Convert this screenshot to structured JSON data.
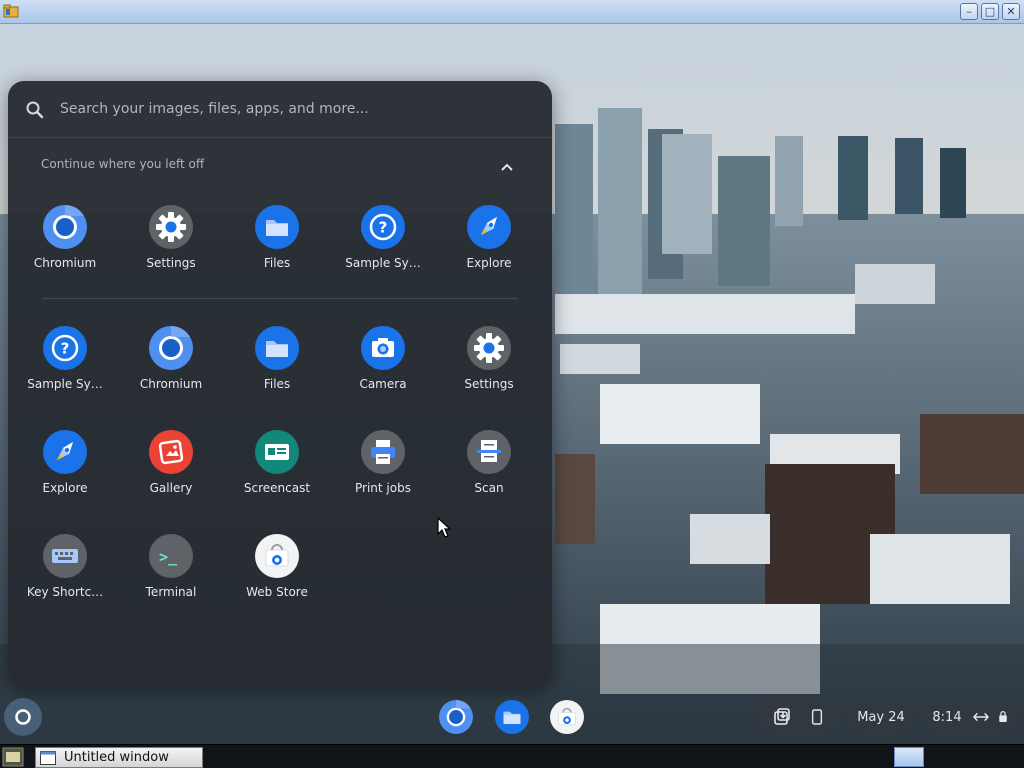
{
  "window": {
    "app_icon": "folder-icon",
    "controls": [
      "minimize-icon",
      "maximize-icon",
      "close-icon"
    ]
  },
  "launcher": {
    "search": {
      "placeholder": "Search your images, files, apps, and more..."
    },
    "continue_label": "Continue where you left off",
    "recent_apps": [
      {
        "label": "Chromium",
        "icon": "chromium-icon"
      },
      {
        "label": "Settings",
        "icon": "settings-gear-icon"
      },
      {
        "label": "Files",
        "icon": "files-folder-icon"
      },
      {
        "label": "Sample Sy…",
        "icon": "help-question-icon"
      },
      {
        "label": "Explore",
        "icon": "explore-rocket-icon"
      }
    ],
    "apps": [
      {
        "label": "Sample Sy…",
        "icon": "help-question-icon"
      },
      {
        "label": "Chromium",
        "icon": "chromium-icon"
      },
      {
        "label": "Files",
        "icon": "files-folder-icon"
      },
      {
        "label": "Camera",
        "icon": "camera-icon"
      },
      {
        "label": "Settings",
        "icon": "settings-gear-icon"
      },
      {
        "label": "Explore",
        "icon": "explore-rocket-icon"
      },
      {
        "label": "Gallery",
        "icon": "gallery-icon"
      },
      {
        "label": "Screencast",
        "icon": "screencast-icon"
      },
      {
        "label": "Print jobs",
        "icon": "printer-icon"
      },
      {
        "label": "Scan",
        "icon": "scanner-icon"
      },
      {
        "label": "Key Shortc…",
        "icon": "keyboard-icon"
      },
      {
        "label": "Terminal",
        "icon": "terminal-icon"
      },
      {
        "label": "Web Store",
        "icon": "web-store-icon"
      }
    ]
  },
  "shelf": {
    "pinned": [
      "chromium-icon",
      "files-folder-icon",
      "web-store-icon"
    ],
    "tray": {
      "date": "May 24",
      "time": "8:14"
    }
  },
  "host_taskbar": {
    "task_label": "Untitled window"
  },
  "colors": {
    "launcher_bg": "#272c32",
    "accent_blue": "#1a73e8",
    "gray_icon": "#5f6368"
  }
}
